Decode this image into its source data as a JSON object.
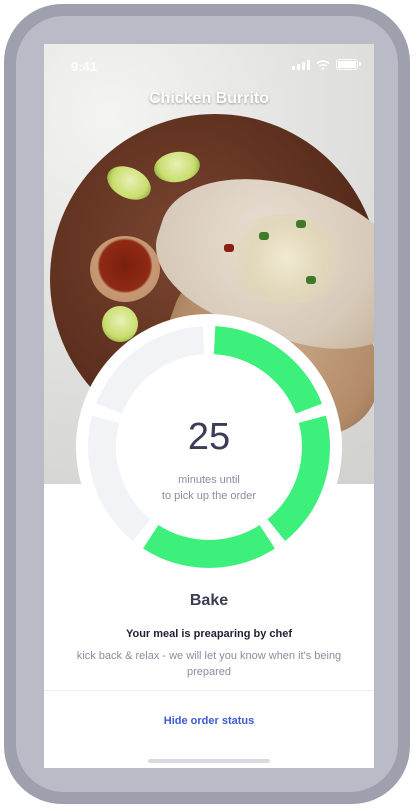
{
  "status_bar": {
    "time": "9:41"
  },
  "header": {
    "title": "Chicken Burrito"
  },
  "timer": {
    "minutes": "25",
    "caption_line1": "minutes until",
    "caption_line2": "to pick up the order",
    "segments_total": 5,
    "segments_done": 3
  },
  "stage": {
    "title": "Bake",
    "headline": "Your meal is preaparing by chef",
    "description": "kick back & relax - we will let you know when it's being prepared"
  },
  "actions": {
    "hide_status": "Hide order status"
  },
  "colors": {
    "accent": "#3df07c",
    "inactive": "#f2f3f6",
    "text_dark": "#3a3d55",
    "link": "#3b5bd6"
  },
  "icons": [
    "signal-icon",
    "wifi-icon",
    "battery-icon"
  ]
}
